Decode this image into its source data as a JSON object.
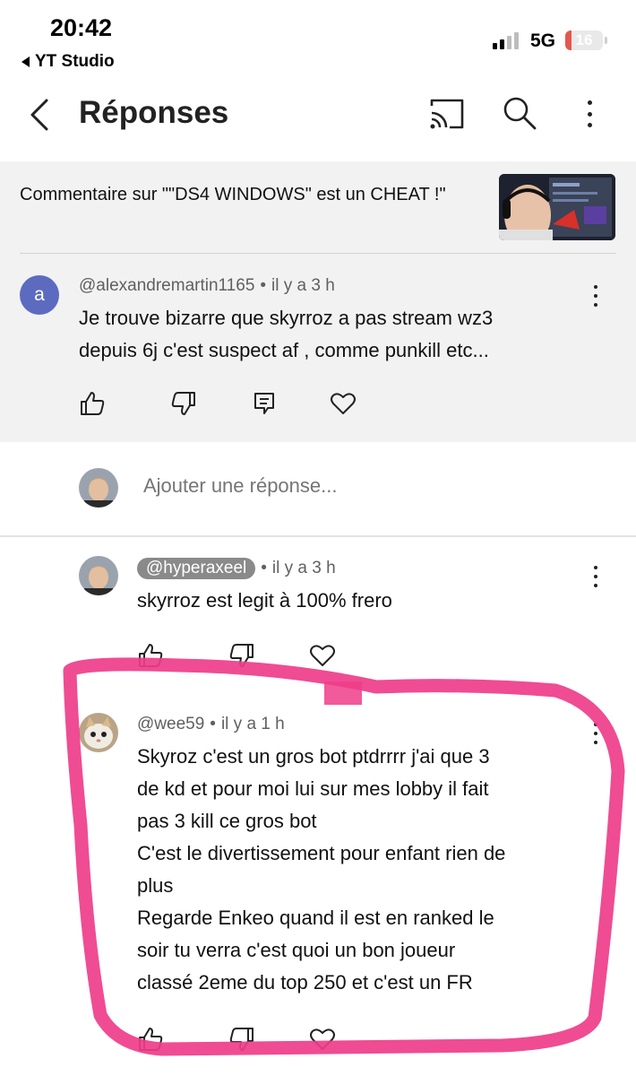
{
  "status_bar": {
    "time": "20:42",
    "back_app": "YT Studio",
    "network": "5G",
    "battery_level": "16",
    "battery_fraction": 0.16,
    "battery_color": "#e5574d"
  },
  "header": {
    "title": "Réponses",
    "icons": [
      "back-arrow-icon",
      "cast-icon",
      "search-icon",
      "more-vertical-icon"
    ]
  },
  "context": {
    "comment_on": "Commentaire sur \"\"DS4 WINDOWS\" est un CHEAT !\""
  },
  "parent_comment": {
    "avatar_letter": "a",
    "avatar_color": "#5c6bc0",
    "author": "@alexandremartin1165",
    "time": "il y a 3 h",
    "lines": [
      "Je trouve bizarre que skyrroz a pas stream wz3",
      "depuis 6j c'est suspect af , comme punkill etc..."
    ]
  },
  "add_reply": {
    "placeholder": "Ajouter une réponse..."
  },
  "replies": [
    {
      "author": "@hyperaxeel",
      "time": "il y a 3 h",
      "lines": [
        "skyrroz est legit à 100% frero"
      ]
    },
    {
      "author": "@wee59",
      "time": "il y a 1 h",
      "lines": [
        "Skyroz c'est un gros bot ptdrrrr j'ai que 3",
        "de kd et pour moi lui sur mes lobby il fait",
        "pas 3 kill ce gros bot",
        "C'est le divertissement pour enfant rien de",
        "plus",
        "Regarde Enkeo quand il est en ranked le",
        "soir tu verra c'est quoi un bon joueur",
        "classé 2eme du top 250 et c'est un FR"
      ]
    }
  ],
  "colors": {
    "highlight": "#ee3d8a",
    "context_bg": "#f2f2f2"
  }
}
